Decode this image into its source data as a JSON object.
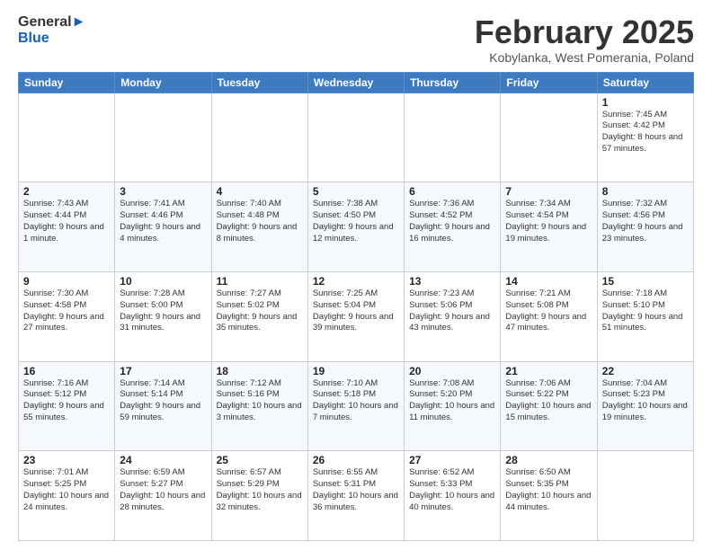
{
  "header": {
    "logo_line1": "General",
    "logo_line2": "Blue",
    "title": "February 2025",
    "subtitle": "Kobylanka, West Pomerania, Poland"
  },
  "weekdays": [
    "Sunday",
    "Monday",
    "Tuesday",
    "Wednesday",
    "Thursday",
    "Friday",
    "Saturday"
  ],
  "weeks": [
    [
      {
        "day": "",
        "info": ""
      },
      {
        "day": "",
        "info": ""
      },
      {
        "day": "",
        "info": ""
      },
      {
        "day": "",
        "info": ""
      },
      {
        "day": "",
        "info": ""
      },
      {
        "day": "",
        "info": ""
      },
      {
        "day": "1",
        "info": "Sunrise: 7:45 AM\nSunset: 4:42 PM\nDaylight: 8 hours\nand 57 minutes."
      }
    ],
    [
      {
        "day": "2",
        "info": "Sunrise: 7:43 AM\nSunset: 4:44 PM\nDaylight: 9 hours\nand 1 minute."
      },
      {
        "day": "3",
        "info": "Sunrise: 7:41 AM\nSunset: 4:46 PM\nDaylight: 9 hours\nand 4 minutes."
      },
      {
        "day": "4",
        "info": "Sunrise: 7:40 AM\nSunset: 4:48 PM\nDaylight: 9 hours\nand 8 minutes."
      },
      {
        "day": "5",
        "info": "Sunrise: 7:38 AM\nSunset: 4:50 PM\nDaylight: 9 hours\nand 12 minutes."
      },
      {
        "day": "6",
        "info": "Sunrise: 7:36 AM\nSunset: 4:52 PM\nDaylight: 9 hours\nand 16 minutes."
      },
      {
        "day": "7",
        "info": "Sunrise: 7:34 AM\nSunset: 4:54 PM\nDaylight: 9 hours\nand 19 minutes."
      },
      {
        "day": "8",
        "info": "Sunrise: 7:32 AM\nSunset: 4:56 PM\nDaylight: 9 hours\nand 23 minutes."
      }
    ],
    [
      {
        "day": "9",
        "info": "Sunrise: 7:30 AM\nSunset: 4:58 PM\nDaylight: 9 hours\nand 27 minutes."
      },
      {
        "day": "10",
        "info": "Sunrise: 7:28 AM\nSunset: 5:00 PM\nDaylight: 9 hours\nand 31 minutes."
      },
      {
        "day": "11",
        "info": "Sunrise: 7:27 AM\nSunset: 5:02 PM\nDaylight: 9 hours\nand 35 minutes."
      },
      {
        "day": "12",
        "info": "Sunrise: 7:25 AM\nSunset: 5:04 PM\nDaylight: 9 hours\nand 39 minutes."
      },
      {
        "day": "13",
        "info": "Sunrise: 7:23 AM\nSunset: 5:06 PM\nDaylight: 9 hours\nand 43 minutes."
      },
      {
        "day": "14",
        "info": "Sunrise: 7:21 AM\nSunset: 5:08 PM\nDaylight: 9 hours\nand 47 minutes."
      },
      {
        "day": "15",
        "info": "Sunrise: 7:18 AM\nSunset: 5:10 PM\nDaylight: 9 hours\nand 51 minutes."
      }
    ],
    [
      {
        "day": "16",
        "info": "Sunrise: 7:16 AM\nSunset: 5:12 PM\nDaylight: 9 hours\nand 55 minutes."
      },
      {
        "day": "17",
        "info": "Sunrise: 7:14 AM\nSunset: 5:14 PM\nDaylight: 9 hours\nand 59 minutes."
      },
      {
        "day": "18",
        "info": "Sunrise: 7:12 AM\nSunset: 5:16 PM\nDaylight: 10 hours\nand 3 minutes."
      },
      {
        "day": "19",
        "info": "Sunrise: 7:10 AM\nSunset: 5:18 PM\nDaylight: 10 hours\nand 7 minutes."
      },
      {
        "day": "20",
        "info": "Sunrise: 7:08 AM\nSunset: 5:20 PM\nDaylight: 10 hours\nand 11 minutes."
      },
      {
        "day": "21",
        "info": "Sunrise: 7:06 AM\nSunset: 5:22 PM\nDaylight: 10 hours\nand 15 minutes."
      },
      {
        "day": "22",
        "info": "Sunrise: 7:04 AM\nSunset: 5:23 PM\nDaylight: 10 hours\nand 19 minutes."
      }
    ],
    [
      {
        "day": "23",
        "info": "Sunrise: 7:01 AM\nSunset: 5:25 PM\nDaylight: 10 hours\nand 24 minutes."
      },
      {
        "day": "24",
        "info": "Sunrise: 6:59 AM\nSunset: 5:27 PM\nDaylight: 10 hours\nand 28 minutes."
      },
      {
        "day": "25",
        "info": "Sunrise: 6:57 AM\nSunset: 5:29 PM\nDaylight: 10 hours\nand 32 minutes."
      },
      {
        "day": "26",
        "info": "Sunrise: 6:55 AM\nSunset: 5:31 PM\nDaylight: 10 hours\nand 36 minutes."
      },
      {
        "day": "27",
        "info": "Sunrise: 6:52 AM\nSunset: 5:33 PM\nDaylight: 10 hours\nand 40 minutes."
      },
      {
        "day": "28",
        "info": "Sunrise: 6:50 AM\nSunset: 5:35 PM\nDaylight: 10 hours\nand 44 minutes."
      },
      {
        "day": "",
        "info": ""
      }
    ]
  ]
}
